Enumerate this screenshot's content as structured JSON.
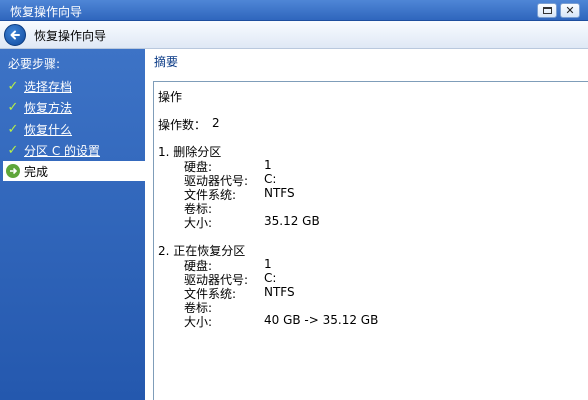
{
  "window": {
    "title": "恢复操作向导"
  },
  "header": {
    "title": "恢复操作向导"
  },
  "sidebar": {
    "steps_title": "必要步骤:",
    "items": [
      {
        "label": "选择存档"
      },
      {
        "label": "恢复方法"
      },
      {
        "label": "恢复什么"
      },
      {
        "label": "分区 C 的设置"
      },
      {
        "label": "完成"
      }
    ]
  },
  "main": {
    "title": "摘要",
    "summary": {
      "section": "操作",
      "op_count_label": "操作数：",
      "op_count": "2",
      "operations": [
        {
          "title": "1. 删除分区",
          "rows": [
            {
              "k": "硬盘:",
              "v": "1"
            },
            {
              "k": "驱动器代号:",
              "v": "C:"
            },
            {
              "k": "文件系统:",
              "v": "NTFS"
            },
            {
              "k": "卷标:",
              "v": ""
            },
            {
              "k": "大小:",
              "v": "35.12 GB"
            }
          ]
        },
        {
          "title": "2. 正在恢复分区",
          "rows": [
            {
              "k": "硬盘:",
              "v": "1"
            },
            {
              "k": "驱动器代号:",
              "v": "C:"
            },
            {
              "k": "文件系统:",
              "v": "NTFS"
            },
            {
              "k": "卷标:",
              "v": ""
            },
            {
              "k": "大小:",
              "v": "40 GB -> 35.12 GB"
            }
          ]
        }
      ]
    }
  }
}
